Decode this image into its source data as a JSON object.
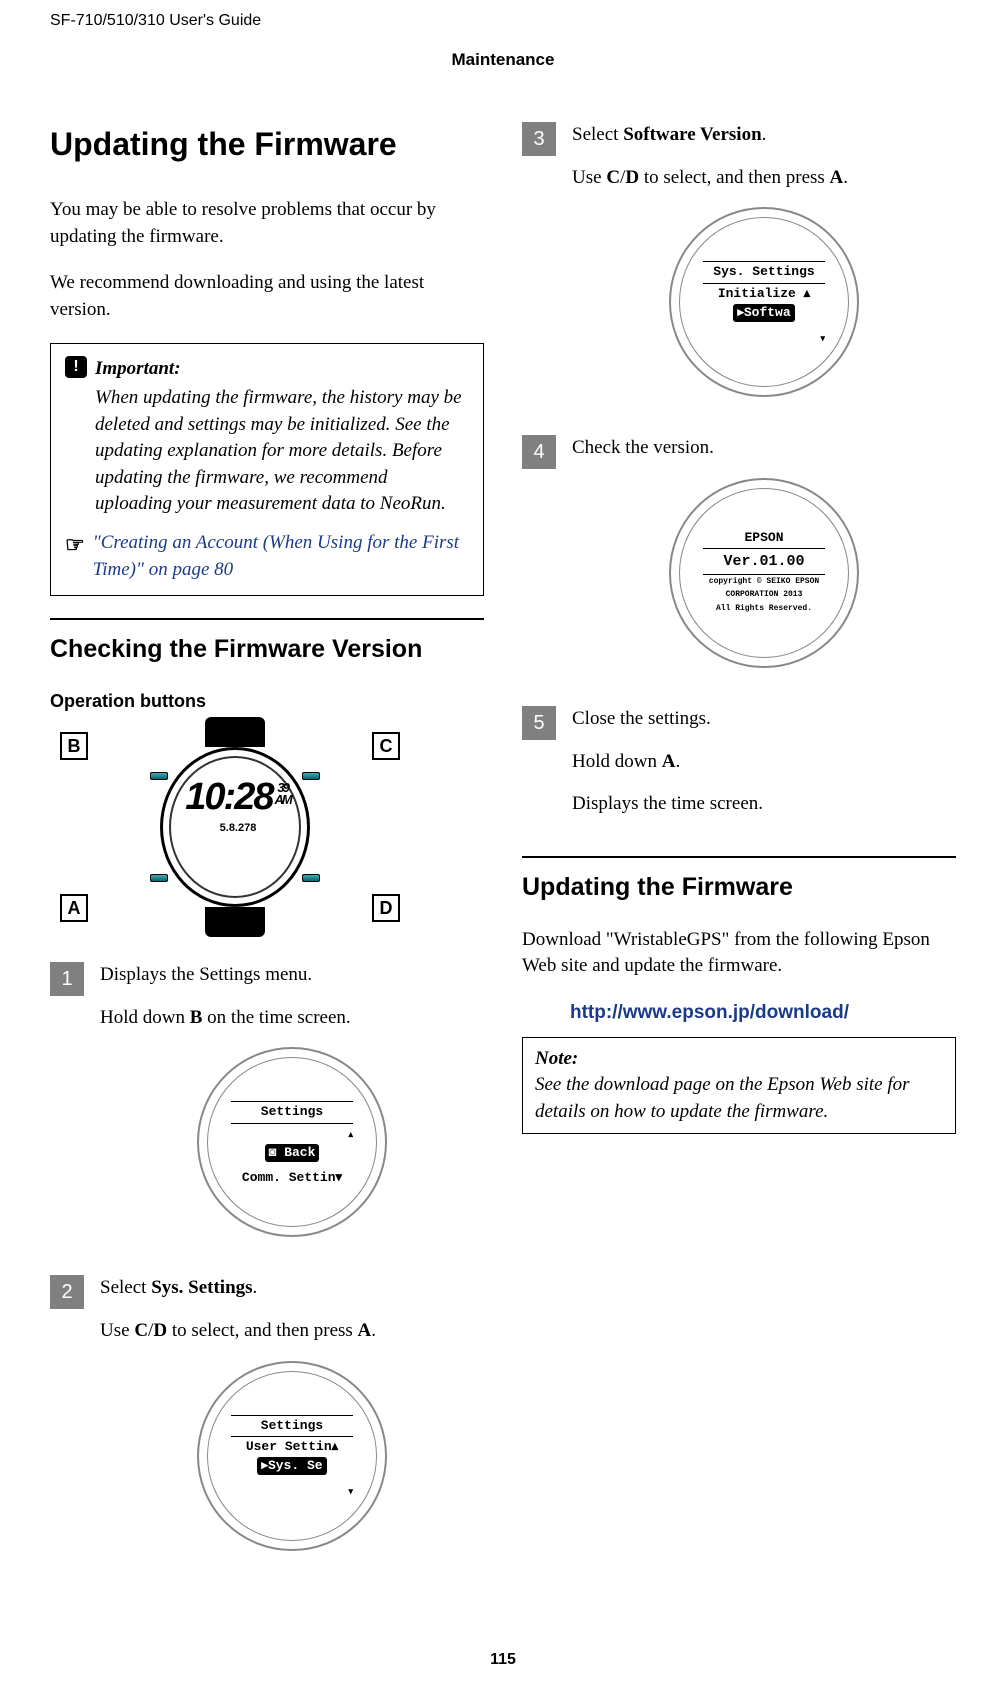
{
  "header": {
    "doc_title": "SF-710/510/310     User's Guide",
    "section": "Maintenance"
  },
  "left": {
    "h1": "Updating the Firmware",
    "intro1": "You may be able to resolve problems that occur by updating the firmware.",
    "intro2": "We recommend downloading and using the latest version.",
    "important": {
      "label": "Important:",
      "body": "When updating the firmware, the history may be deleted and settings may be initialized. See the updating explanation for more details. Before updating the firmware, we recommend uploading your measurement data to NeoRun.",
      "xref_icon": "☞",
      "xref": "\"Creating an Account (When Using for the First Time)\" on page 80"
    },
    "h2": "Checking the Firmware Version",
    "h3": "Operation buttons",
    "watch": {
      "labelA": "A",
      "labelB": "B",
      "labelC": "C",
      "labelD": "D",
      "time_main": "10:28",
      "time_sec": "39",
      "time_ampm": "AM",
      "time_sub": "5.8.278"
    },
    "step1": {
      "num": "1",
      "l1": "Displays the Settings menu.",
      "l2_pre": "Hold down ",
      "l2_bold": "B",
      "l2_post": " on the time screen.",
      "screen": {
        "title": "Settings",
        "row_inv": "◙ Back",
        "row3": "Comm. Settin▾"
      }
    },
    "step2": {
      "num": "2",
      "l1_pre": "Select ",
      "l1_bold": "Sys. Settings",
      "l1_post": ".",
      "l2_pre": "Use ",
      "l2_b1": "C",
      "l2_mid": "/",
      "l2_b2": "D",
      "l2_post1": " to select, and then press ",
      "l2_b3": "A",
      "l2_post2": ".",
      "screen": {
        "title": "Settings",
        "row2": "User Settin▴",
        "row_inv": "▸Sys. Se"
      }
    }
  },
  "right": {
    "step3": {
      "num": "3",
      "l1_pre": "Select ",
      "l1_bold": "Software Version",
      "l1_post": ".",
      "l2_pre": "Use ",
      "l2_b1": "C",
      "l2_mid": "/",
      "l2_b2": "D",
      "l2_post1": " to select, and then press ",
      "l2_b3": "A",
      "l2_post2": ".",
      "screen": {
        "title": "Sys. Settings",
        "row2": "Initialize ▴",
        "row_inv": "▸Softwa"
      }
    },
    "step4": {
      "num": "4",
      "l1": "Check the version.",
      "screen": {
        "r1": "EPSON",
        "r2": "Ver.01.00",
        "r3": "copyright © SEIKO EPSON",
        "r4": "CORPORATION 2013",
        "r5": "All Rights Reserved."
      }
    },
    "step5": {
      "num": "5",
      "l1": "Close the settings.",
      "l2_pre": "Hold down ",
      "l2_bold": "A",
      "l2_post": ".",
      "l3": "Displays the time screen."
    },
    "h2": "Updating the Firmware",
    "download_text": "Download \"WristableGPS\" from the following Epson Web site and update the firmware.",
    "download_link": "http://www.epson.jp/download/",
    "note": {
      "label": "Note:",
      "body": "See the download page on the Epson Web site for details on how to update the firmware."
    }
  },
  "page_number": "115"
}
